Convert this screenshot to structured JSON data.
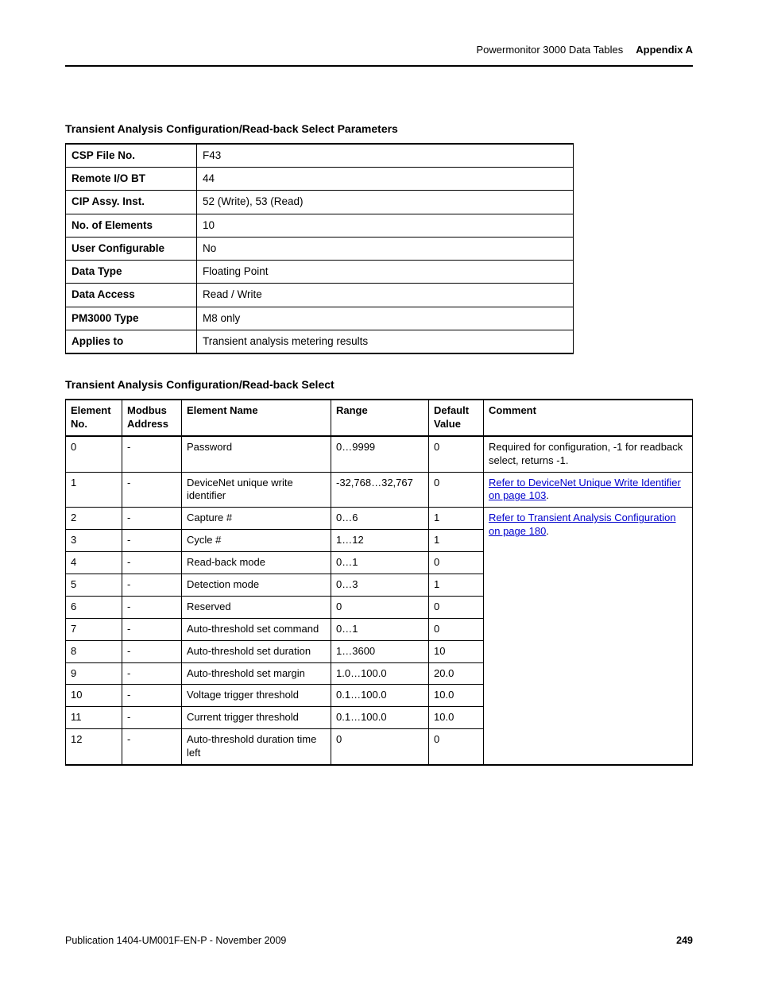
{
  "header": {
    "doc_section": "Powermonitor 3000 Data Tables",
    "appendix": "Appendix A"
  },
  "section1_title": "Transient Analysis Configuration/Read-back Select Parameters",
  "table1": [
    {
      "label": "CSP File No.",
      "value": "F43"
    },
    {
      "label": "Remote I/O BT",
      "value": "44"
    },
    {
      "label": "CIP Assy. Inst.",
      "value": "52 (Write), 53 (Read)"
    },
    {
      "label": "No. of Elements",
      "value": "10"
    },
    {
      "label": "User Configurable",
      "value": "No"
    },
    {
      "label": "Data Type",
      "value": "Floating Point"
    },
    {
      "label": "Data Access",
      "value": "Read / Write"
    },
    {
      "label": "PM3000 Type",
      "value": "M8 only"
    },
    {
      "label": "Applies to",
      "value": "Transient analysis metering results"
    }
  ],
  "section2_title": "Transient Analysis Configuration/Read-back Select",
  "table2": {
    "headers": {
      "el": "Element No.",
      "mod": "Modbus Address",
      "name": "Element Name",
      "range": "Range",
      "def": "Default Value",
      "comment": "Comment"
    },
    "rows": [
      {
        "el": "0",
        "mod": "-",
        "name": "Password",
        "range": "0…9999",
        "def": "0"
      },
      {
        "el": "1",
        "mod": "-",
        "name": "DeviceNet unique write identifier",
        "range": "-32,768…32,767",
        "def": "0"
      },
      {
        "el": "2",
        "mod": "-",
        "name": "Capture #",
        "range": "0…6",
        "def": "1"
      },
      {
        "el": "3",
        "mod": "-",
        "name": "Cycle #",
        "range": "1…12",
        "def": "1"
      },
      {
        "el": "4",
        "mod": "-",
        "name": "Read-back mode",
        "range": "0…1",
        "def": "0"
      },
      {
        "el": "5",
        "mod": "-",
        "name": "Detection mode",
        "range": "0…3",
        "def": "1"
      },
      {
        "el": "6",
        "mod": "-",
        "name": "Reserved",
        "range": "0",
        "def": "0"
      },
      {
        "el": "7",
        "mod": "-",
        "name": "Auto-threshold set command",
        "range": "0…1",
        "def": "0"
      },
      {
        "el": "8",
        "mod": "-",
        "name": "Auto-threshold set duration",
        "range": "1…3600",
        "def": "10"
      },
      {
        "el": "9",
        "mod": "-",
        "name": "Auto-threshold set margin",
        "range": "1.0…100.0",
        "def": "20.0"
      },
      {
        "el": "10",
        "mod": "-",
        "name": "Voltage trigger threshold",
        "range": "0.1…100.0",
        "def": "10.0"
      },
      {
        "el": "11",
        "mod": "-",
        "name": "Current trigger threshold",
        "range": "0.1…100.0",
        "def": "10.0"
      },
      {
        "el": "12",
        "mod": "-",
        "name": "Auto-threshold duration time left",
        "range": "0",
        "def": "0"
      }
    ],
    "comments": {
      "row0": "Required for configuration, -1 for readback select, returns -1.",
      "row1_pre": "",
      "row1_link": "Refer to DeviceNet Unique Write Identifier on page 103",
      "row1_post": ".",
      "row2_link": "Refer to Transient Analysis Configuration on page 180",
      "row2_post": "."
    }
  },
  "footer": {
    "pub": "Publication 1404-UM001F-EN-P - November 2009",
    "page": "249"
  }
}
